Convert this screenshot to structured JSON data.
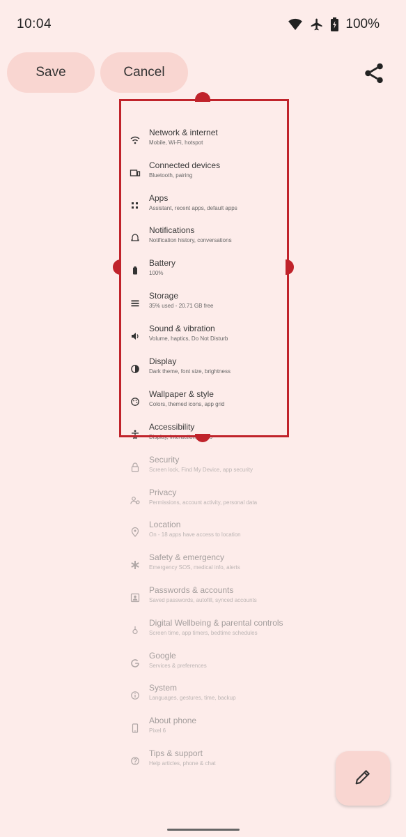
{
  "status_bar": {
    "time": "10:04",
    "battery": "100%"
  },
  "toolbar": {
    "save_label": "Save",
    "cancel_label": "Cancel"
  },
  "settings_items": [
    {
      "title": "Network & internet",
      "subtitle": "Mobile, Wi-Fi, hotspot",
      "icon": "wifi-icon"
    },
    {
      "title": "Connected devices",
      "subtitle": "Bluetooth, pairing",
      "icon": "devices-icon"
    },
    {
      "title": "Apps",
      "subtitle": "Assistant, recent apps, default apps",
      "icon": "apps-icon"
    },
    {
      "title": "Notifications",
      "subtitle": "Notification history, conversations",
      "icon": "bell-icon"
    },
    {
      "title": "Battery",
      "subtitle": "100%",
      "icon": "battery-icon"
    },
    {
      "title": "Storage",
      "subtitle": "35% used - 20.71 GB free",
      "icon": "storage-icon"
    },
    {
      "title": "Sound & vibration",
      "subtitle": "Volume, haptics, Do Not Disturb",
      "icon": "volume-icon"
    },
    {
      "title": "Display",
      "subtitle": "Dark theme, font size, brightness",
      "icon": "display-icon"
    },
    {
      "title": "Wallpaper & style",
      "subtitle": "Colors, themed icons, app grid",
      "icon": "palette-icon"
    },
    {
      "title": "Accessibility",
      "subtitle": "Display, interaction, audio",
      "icon": "accessibility-icon"
    },
    {
      "title": "Security",
      "subtitle": "Screen lock, Find My Device, app security",
      "icon": "lock-icon"
    },
    {
      "title": "Privacy",
      "subtitle": "Permissions, account activity, personal data",
      "icon": "privacy-icon"
    },
    {
      "title": "Location",
      "subtitle": "On - 18 apps have access to location",
      "icon": "location-icon"
    },
    {
      "title": "Safety & emergency",
      "subtitle": "Emergency SOS, medical info, alerts",
      "icon": "emergency-icon"
    },
    {
      "title": "Passwords & accounts",
      "subtitle": "Saved passwords, autofill, synced accounts",
      "icon": "account-icon"
    },
    {
      "title": "Digital Wellbeing & parental controls",
      "subtitle": "Screen time, app timers, bedtime schedules",
      "icon": "wellbeing-icon"
    },
    {
      "title": "Google",
      "subtitle": "Services & preferences",
      "icon": "google-icon"
    },
    {
      "title": "System",
      "subtitle": "Languages, gestures, time, backup",
      "icon": "system-icon"
    },
    {
      "title": "About phone",
      "subtitle": "Pixel 6",
      "icon": "phone-icon"
    },
    {
      "title": "Tips & support",
      "subtitle": "Help articles, phone & chat",
      "icon": "help-icon"
    }
  ],
  "colors": {
    "background": "#fdecea",
    "crop_accent": "#c0232b",
    "button_fill": "#f9d6d1"
  }
}
